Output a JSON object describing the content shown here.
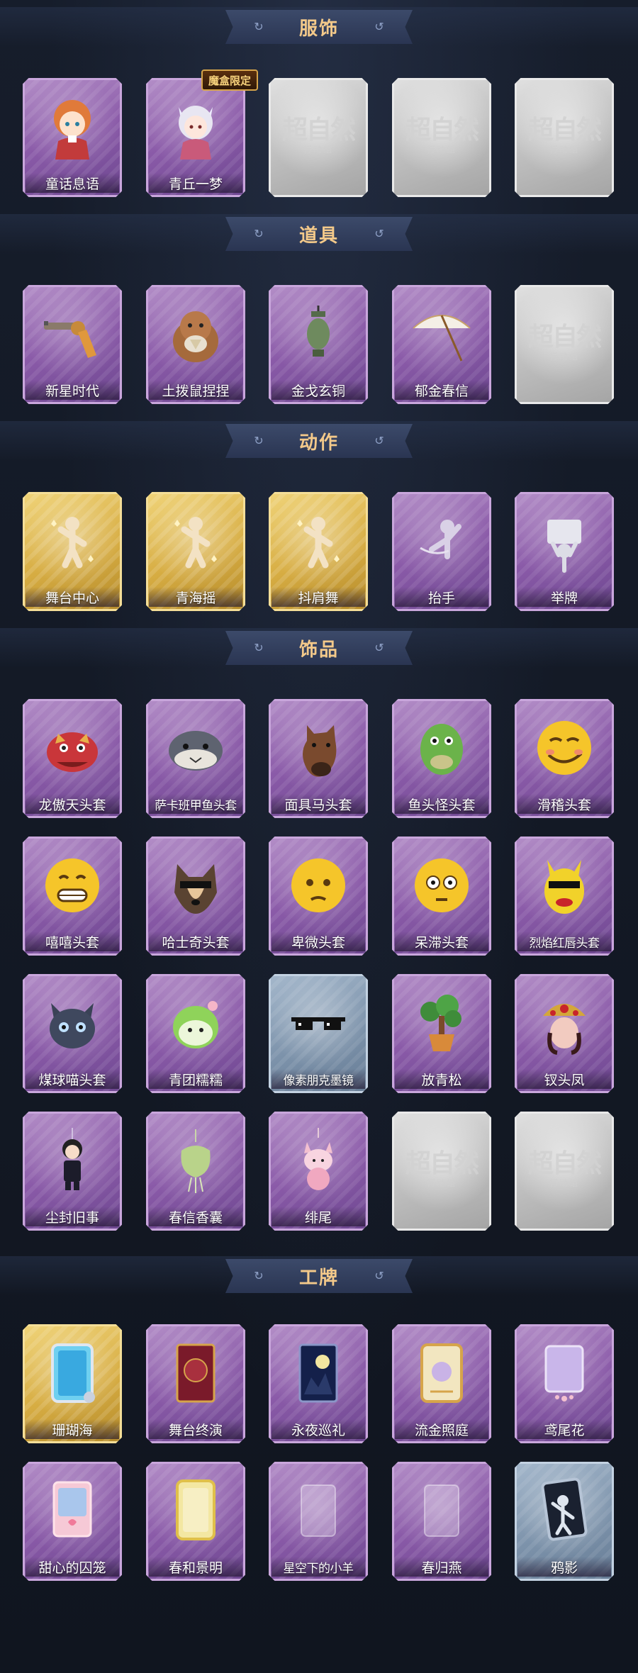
{
  "sections": [
    {
      "title": "服饰",
      "items": [
        {
          "label": "童话息语",
          "style": "purple",
          "icon": "girl-doll-icon"
        },
        {
          "label": "青丘一梦",
          "style": "purple",
          "icon": "fox-girl-icon",
          "badge": "魔盒限定"
        },
        {
          "placeholder": "超自然",
          "placeholder_sub": "行动组",
          "style": "gray",
          "icon": "placeholder-logo-icon"
        },
        {
          "placeholder": "超自然",
          "placeholder_sub": "行动组",
          "style": "gray",
          "icon": "placeholder-logo-icon"
        },
        {
          "placeholder": "超自然",
          "placeholder_sub": "行动组",
          "style": "gray",
          "icon": "placeholder-logo-icon"
        }
      ]
    },
    {
      "title": "道具",
      "items": [
        {
          "label": "新星时代",
          "style": "purple",
          "icon": "revolver-icon"
        },
        {
          "label": "土拨鼠捏捏",
          "style": "purple",
          "icon": "groundhog-icon"
        },
        {
          "label": "金戈玄铜",
          "style": "purple",
          "icon": "lantern-icon"
        },
        {
          "label": "郁金春信",
          "style": "purple",
          "icon": "paper-umbrella-icon"
        },
        {
          "placeholder": "超自然",
          "placeholder_sub": "行动组",
          "style": "gray",
          "icon": "placeholder-logo-icon"
        }
      ]
    },
    {
      "title": "动作",
      "items": [
        {
          "label": "舞台中心",
          "style": "gold",
          "icon": "dance-pose-icon"
        },
        {
          "label": "青海摇",
          "style": "gold",
          "icon": "dance-pose-icon"
        },
        {
          "label": "抖肩舞",
          "style": "gold",
          "icon": "dance-pose-icon"
        },
        {
          "label": "抬手",
          "style": "purple",
          "icon": "raise-hand-icon"
        },
        {
          "label": "举牌",
          "style": "purple",
          "icon": "hold-sign-icon"
        }
      ]
    },
    {
      "title": "饰品",
      "items": [
        {
          "label": "龙傲天头套",
          "style": "purple",
          "icon": "dragon-head-icon"
        },
        {
          "label": "萨卡班甲鱼头套",
          "style": "purple",
          "icon": "fish-head-icon"
        },
        {
          "label": "面具马头套",
          "style": "purple",
          "icon": "horse-head-icon"
        },
        {
          "label": "鱼头怪头套",
          "style": "purple",
          "icon": "green-fish-icon"
        },
        {
          "label": "滑稽头套",
          "style": "purple",
          "icon": "smirk-emoji-icon"
        },
        {
          "label": "嘻嘻头套",
          "style": "purple",
          "icon": "grin-emoji-icon"
        },
        {
          "label": "哈士奇头套",
          "style": "purple",
          "icon": "husky-head-icon"
        },
        {
          "label": "卑微头套",
          "style": "purple",
          "icon": "pleading-emoji-icon"
        },
        {
          "label": "呆滞头套",
          "style": "purple",
          "icon": "dazed-emoji-icon"
        },
        {
          "label": "烈焰红唇头套",
          "style": "purple",
          "icon": "yellow-mascot-icon"
        },
        {
          "label": "煤球喵头套",
          "style": "purple",
          "icon": "black-cat-icon"
        },
        {
          "label": "青团糯糯",
          "style": "purple",
          "icon": "green-dumpling-icon"
        },
        {
          "label": "像素朋克墨镜",
          "style": "steel",
          "icon": "pixel-sunglasses-icon"
        },
        {
          "label": "放青松",
          "style": "purple",
          "icon": "bonsai-pine-icon"
        },
        {
          "label": "钗头凤",
          "style": "purple",
          "icon": "phoenix-headdress-icon"
        },
        {
          "label": "尘封旧事",
          "style": "purple",
          "icon": "boy-charm-icon"
        },
        {
          "label": "春信香囊",
          "style": "purple",
          "icon": "sachet-icon"
        },
        {
          "label": "绯尾",
          "style": "purple",
          "icon": "pink-fox-icon"
        },
        {
          "placeholder": "超自然",
          "placeholder_sub": "行动组",
          "style": "gray",
          "icon": "placeholder-logo-icon"
        },
        {
          "placeholder": "超自然",
          "placeholder_sub": "行动组",
          "style": "gray",
          "icon": "placeholder-logo-icon"
        }
      ]
    },
    {
      "title": "工牌",
      "items": [
        {
          "label": "珊瑚海",
          "style": "gold",
          "icon": "coral-badge-icon"
        },
        {
          "label": "舞台终演",
          "style": "purple",
          "icon": "stage-badge-icon"
        },
        {
          "label": "永夜巡礼",
          "style": "purple",
          "icon": "night-moon-badge-icon"
        },
        {
          "label": "流金照庭",
          "style": "purple",
          "icon": "golden-frame-badge-icon"
        },
        {
          "label": "鸢尾花",
          "style": "purple",
          "icon": "iris-badge-icon"
        },
        {
          "label": "甜心的囚笼",
          "style": "purple",
          "icon": "sweetheart-badge-icon"
        },
        {
          "label": "春和景明",
          "style": "purple",
          "icon": "spring-badge-icon"
        },
        {
          "label": "星空下的小羊",
          "style": "purple",
          "icon": "star-lamb-badge-icon"
        },
        {
          "label": "春归燕",
          "style": "purple",
          "icon": "swallow-badge-icon"
        },
        {
          "label": "鸦影",
          "style": "steel",
          "icon": "crow-silhouette-badge-icon"
        }
      ]
    }
  ]
}
